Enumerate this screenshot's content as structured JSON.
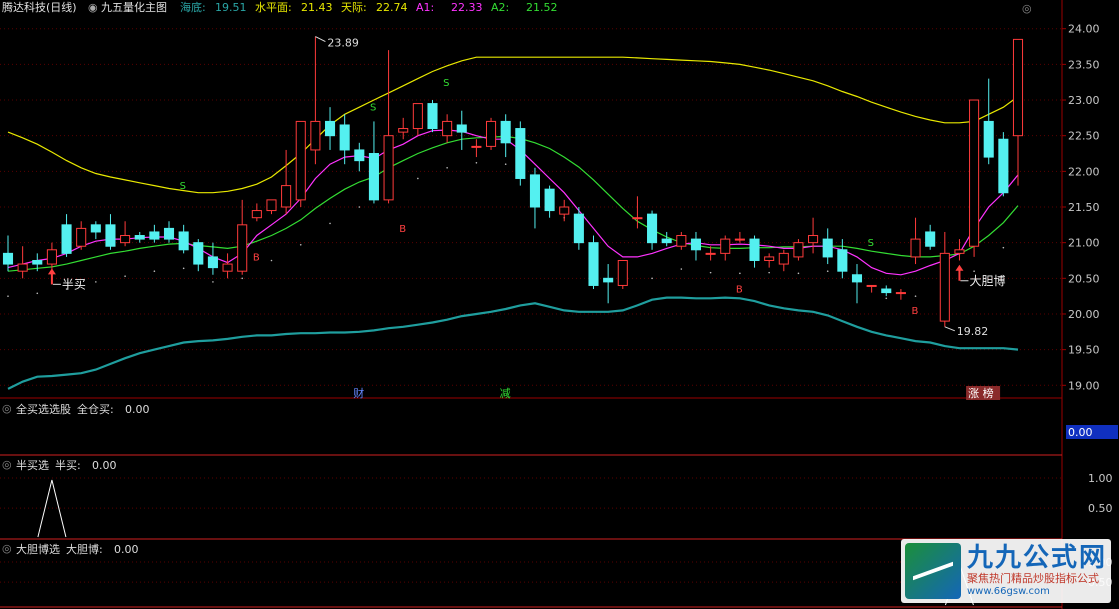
{
  "header": {
    "stock": "腾达科技(日线)",
    "indicator": "九五量化主图",
    "items": [
      {
        "label": "海底:",
        "value": "19.51",
        "color": "#2aa6a6"
      },
      {
        "label": "水平面:",
        "value": "21.43",
        "color": "#e8e800"
      },
      {
        "label": "天际:",
        "value": "22.74",
        "color": "#e8e800"
      },
      {
        "label": "A1:",
        "value": "22.33",
        "color": "#ff33ff"
      },
      {
        "label": "A2:",
        "value": "21.52",
        "color": "#33dd33"
      }
    ]
  },
  "colors": {
    "up": "#ff3b3b",
    "down": "#54f0f0",
    "ma1": "#ff33ff",
    "ma2": "#33dd33",
    "upper": "#e8e800",
    "lower": "#1f9e9e",
    "grid": "#5a0000",
    "axis": "#9b0000"
  },
  "chart_data": {
    "type": "candlestick",
    "y_ticks": [
      "24.00",
      "23.50",
      "23.00",
      "22.50",
      "22.00",
      "21.50",
      "21.00",
      "20.50",
      "20.00",
      "19.50",
      "19.00"
    ],
    "ylim": [
      18.85,
      24.15
    ],
    "candles": [
      [
        20.85,
        21.1,
        20.7,
        20.6
      ],
      [
        20.6,
        20.95,
        20.7,
        20.5
      ],
      [
        20.75,
        20.85,
        20.7,
        20.6
      ],
      [
        20.7,
        21.0,
        20.9,
        20.6
      ],
      [
        21.25,
        21.4,
        20.85,
        20.8
      ],
      [
        20.95,
        21.3,
        21.2,
        20.9
      ],
      [
        21.25,
        21.3,
        21.15,
        21.05
      ],
      [
        21.25,
        21.4,
        20.95,
        20.9
      ],
      [
        21.0,
        21.3,
        21.1,
        20.95
      ],
      [
        21.1,
        21.15,
        21.05,
        21.0
      ],
      [
        21.15,
        21.25,
        21.05,
        21.0
      ],
      [
        21.2,
        21.3,
        21.05,
        21.0
      ],
      [
        21.15,
        21.25,
        20.9,
        20.85
      ],
      [
        21.0,
        21.05,
        20.7,
        20.6
      ],
      [
        20.8,
        21.0,
        20.65,
        20.55
      ],
      [
        20.6,
        20.85,
        20.7,
        20.5
      ],
      [
        20.6,
        21.6,
        21.25,
        20.55
      ],
      [
        21.35,
        21.55,
        21.45,
        21.3
      ],
      [
        21.45,
        21.6,
        21.6,
        21.4
      ],
      [
        21.5,
        22.3,
        21.8,
        21.4
      ],
      [
        21.6,
        22.7,
        22.7,
        21.5
      ],
      [
        22.3,
        23.89,
        22.7,
        22.1
      ],
      [
        22.7,
        22.9,
        22.5,
        22.3
      ],
      [
        22.65,
        22.8,
        22.3,
        22.1
      ],
      [
        22.3,
        22.4,
        22.15,
        22.0
      ],
      [
        22.25,
        22.7,
        21.6,
        21.55
      ],
      [
        21.6,
        23.7,
        22.5,
        21.55
      ],
      [
        22.55,
        22.75,
        22.6,
        22.45
      ],
      [
        22.6,
        22.95,
        22.95,
        22.5
      ],
      [
        22.95,
        23.0,
        22.6,
        22.55
      ],
      [
        22.5,
        22.8,
        22.7,
        22.4
      ],
      [
        22.65,
        22.85,
        22.55,
        22.3
      ],
      [
        22.35,
        22.45,
        22.35,
        22.2
      ],
      [
        22.35,
        22.75,
        22.7,
        22.3
      ],
      [
        22.7,
        22.8,
        22.4,
        22.2
      ],
      [
        22.6,
        22.7,
        21.9,
        21.8
      ],
      [
        21.95,
        22.05,
        21.5,
        21.2
      ],
      [
        21.75,
        21.8,
        21.45,
        21.35
      ],
      [
        21.4,
        21.6,
        21.5,
        21.3
      ],
      [
        21.4,
        21.5,
        21.0,
        20.9
      ],
      [
        21.0,
        21.1,
        20.4,
        20.35
      ],
      [
        20.5,
        20.7,
        20.45,
        20.15
      ],
      [
        20.4,
        20.75,
        20.75,
        20.35
      ],
      [
        21.35,
        21.65,
        21.35,
        21.2
      ],
      [
        21.4,
        21.45,
        21.0,
        20.9
      ],
      [
        21.05,
        21.15,
        21.0,
        20.95
      ],
      [
        20.95,
        21.15,
        21.1,
        20.9
      ],
      [
        21.05,
        21.15,
        20.9,
        20.75
      ],
      [
        20.85,
        20.95,
        20.85,
        20.75
      ],
      [
        20.85,
        21.1,
        21.05,
        20.75
      ],
      [
        21.05,
        21.15,
        21.05,
        21.0
      ],
      [
        21.05,
        21.1,
        20.75,
        20.65
      ],
      [
        20.75,
        20.85,
        20.8,
        20.65
      ],
      [
        20.7,
        20.9,
        20.85,
        20.6
      ],
      [
        20.8,
        21.05,
        21.0,
        20.75
      ],
      [
        21.0,
        21.35,
        21.1,
        20.85
      ],
      [
        21.05,
        21.2,
        20.8,
        20.7
      ],
      [
        20.9,
        21.05,
        20.6,
        20.5
      ],
      [
        20.55,
        20.7,
        20.45,
        20.15
      ],
      [
        20.4,
        20.4,
        20.4,
        20.3
      ],
      [
        20.35,
        20.4,
        20.3,
        20.25
      ],
      [
        20.3,
        20.35,
        20.3,
        20.2
      ],
      [
        20.8,
        21.35,
        21.05,
        20.7
      ],
      [
        21.15,
        21.25,
        20.95,
        20.9
      ],
      [
        19.9,
        21.15,
        20.85,
        19.82
      ],
      [
        20.85,
        21.05,
        20.9,
        20.75
      ],
      [
        20.95,
        23.0,
        23.0,
        20.8
      ],
      [
        22.7,
        23.3,
        22.2,
        22.1
      ],
      [
        22.45,
        22.55,
        21.7,
        21.65
      ],
      [
        22.5,
        23.85,
        23.85,
        21.8
      ]
    ],
    "ma1": [
      20.65,
      20.7,
      20.75,
      20.78,
      20.85,
      20.95,
      21.02,
      21.05,
      21.05,
      21.07,
      21.08,
      21.08,
      21.02,
      20.92,
      20.8,
      20.72,
      20.85,
      21.1,
      21.25,
      21.4,
      21.62,
      21.9,
      22.1,
      22.2,
      22.22,
      22.18,
      22.3,
      22.38,
      22.5,
      22.57,
      22.58,
      22.56,
      22.5,
      22.45,
      22.45,
      22.3,
      22.1,
      21.9,
      21.7,
      21.45,
      21.2,
      20.95,
      20.8,
      20.8,
      20.85,
      20.92,
      20.98,
      21.0,
      20.97,
      20.97,
      20.98,
      20.97,
      20.95,
      20.92,
      20.92,
      20.95,
      20.95,
      20.9,
      20.8,
      20.65,
      20.57,
      20.55,
      20.6,
      20.68,
      20.75,
      20.85,
      21.2,
      21.5,
      21.7,
      21.95
    ],
    "ma2": [
      20.6,
      20.62,
      20.64,
      20.66,
      20.7,
      20.75,
      20.8,
      20.85,
      20.88,
      20.92,
      20.95,
      20.98,
      20.99,
      20.96,
      20.94,
      20.92,
      20.95,
      21.02,
      21.1,
      21.2,
      21.32,
      21.48,
      21.62,
      21.75,
      21.85,
      21.92,
      22.05,
      22.15,
      22.25,
      22.33,
      22.4,
      22.45,
      22.47,
      22.48,
      22.49,
      22.46,
      22.4,
      22.32,
      22.2,
      22.06,
      21.88,
      21.68,
      21.48,
      21.3,
      21.18,
      21.08,
      21.0,
      20.96,
      20.93,
      20.92,
      20.92,
      20.93,
      20.93,
      20.94,
      20.94,
      20.95,
      20.95,
      20.95,
      20.92,
      20.88,
      20.85,
      20.82,
      20.8,
      20.8,
      20.82,
      20.84,
      20.95,
      21.1,
      21.28,
      21.52
    ],
    "upper": [
      22.55,
      22.47,
      22.38,
      22.27,
      22.15,
      22.05,
      21.97,
      21.92,
      21.88,
      21.84,
      21.8,
      21.76,
      21.73,
      21.7,
      21.7,
      21.72,
      21.76,
      21.82,
      21.92,
      22.08,
      22.25,
      22.45,
      22.65,
      22.8,
      22.9,
      23.0,
      23.1,
      23.2,
      23.3,
      23.4,
      23.48,
      23.55,
      23.6,
      23.6,
      23.6,
      23.6,
      23.6,
      23.6,
      23.6,
      23.6,
      23.6,
      23.6,
      23.6,
      23.59,
      23.58,
      23.57,
      23.56,
      23.55,
      23.54,
      23.52,
      23.5,
      23.46,
      23.42,
      23.37,
      23.32,
      23.27,
      23.2,
      23.12,
      23.05,
      22.97,
      22.9,
      22.83,
      22.77,
      22.72,
      22.68,
      22.68,
      22.7,
      22.8,
      22.9,
      23.05
    ],
    "lower": [
      18.95,
      19.05,
      19.12,
      19.13,
      19.15,
      19.17,
      19.22,
      19.3,
      19.38,
      19.45,
      19.5,
      19.55,
      19.6,
      19.62,
      19.63,
      19.65,
      19.68,
      19.7,
      19.7,
      19.72,
      19.73,
      19.73,
      19.74,
      19.74,
      19.75,
      19.77,
      19.8,
      19.82,
      19.85,
      19.88,
      19.92,
      19.97,
      20.0,
      20.03,
      20.07,
      20.12,
      20.15,
      20.1,
      20.05,
      20.03,
      20.03,
      20.03,
      20.05,
      20.12,
      20.2,
      20.23,
      20.23,
      20.22,
      20.22,
      20.23,
      20.22,
      20.18,
      20.12,
      20.08,
      20.05,
      20.03,
      19.98,
      19.9,
      19.82,
      19.75,
      19.7,
      19.66,
      19.62,
      19.6,
      19.55,
      19.52,
      19.52,
      19.52,
      19.52,
      19.5
    ],
    "annotations": {
      "high": {
        "label": "23.89",
        "index": 21,
        "price": 23.89
      },
      "low": {
        "label": "19.82",
        "index": 64,
        "price": 19.82
      },
      "signals": [
        {
          "text": "S",
          "index": 12,
          "price": 21.75,
          "color": "#33dd33"
        },
        {
          "text": "S",
          "index": 25,
          "price": 22.85,
          "color": "#33dd33"
        },
        {
          "text": "S",
          "index": 30,
          "price": 23.2,
          "color": "#33dd33"
        },
        {
          "text": "S",
          "index": 59,
          "price": 20.95,
          "color": "#33dd33"
        },
        {
          "text": "B",
          "index": 17,
          "price": 20.75,
          "color": "#ff4040"
        },
        {
          "text": "B",
          "index": 27,
          "price": 21.15,
          "color": "#ff4040"
        },
        {
          "text": "B",
          "index": 50,
          "price": 20.3,
          "color": "#ff4040"
        },
        {
          "text": "B",
          "index": 62,
          "price": 20.0,
          "color": "#ff4040"
        }
      ],
      "arrows": [
        {
          "text": "半买",
          "index": 3,
          "price": 20.5
        },
        {
          "text": "大胆博",
          "index": 65,
          "price": 20.55
        }
      ]
    },
    "event_labels": [
      {
        "text": "财",
        "index": 24,
        "color": "#6688ff",
        "bg": ""
      },
      {
        "text": "减",
        "index": 34,
        "color": "#33dd33",
        "bg": ""
      },
      {
        "text": "涨 榜",
        "index": 66,
        "color": "#ffffff",
        "bg": "#8a2a2a"
      }
    ],
    "subpanels": [
      {
        "title": "全买选选股",
        "label": "全仓买:",
        "value": "0.00",
        "ticks": [],
        "badge": "0.00"
      },
      {
        "title": "半买选",
        "label": "半买:",
        "value": "0.00",
        "ticks": [
          "1.00",
          "0.50"
        ],
        "spike_index": 3
      },
      {
        "title": "大胆博选",
        "label": "大胆博:",
        "value": "0.00",
        "ticks": [
          "1.00",
          "0.50"
        ],
        "spike_index": 65
      }
    ]
  },
  "watermark": {
    "title": "九九公式网",
    "subtitle": "聚焦热门精品炒股指标公式",
    "url": "www.66gsw.com"
  }
}
